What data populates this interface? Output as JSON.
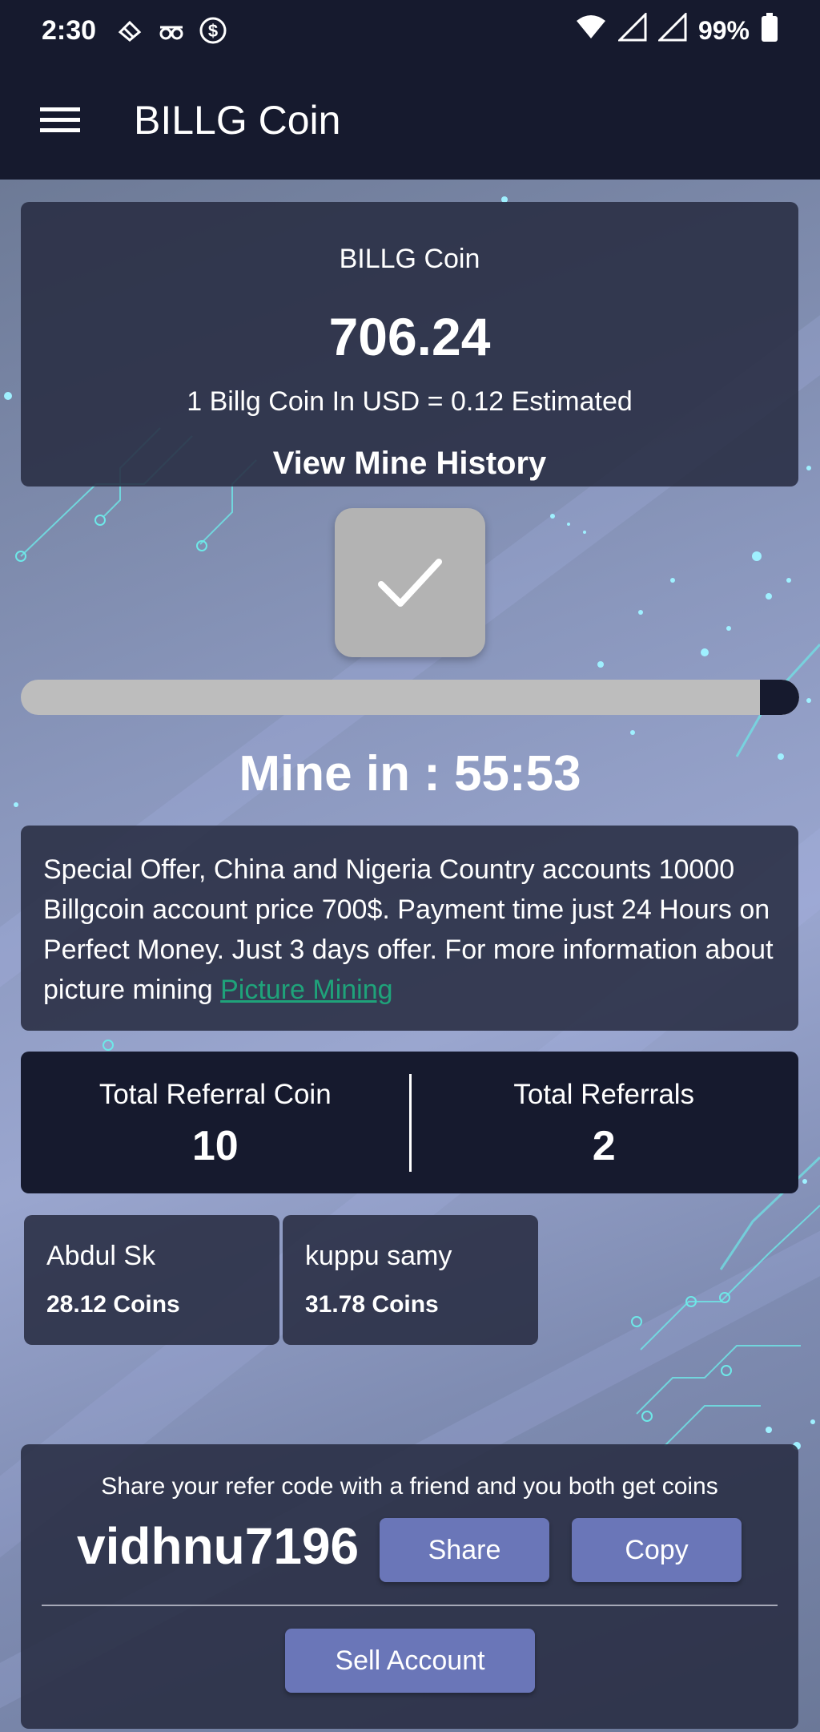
{
  "status_bar": {
    "time": "2:30",
    "battery": "99%",
    "icons": [
      "notification-icon",
      "spy-icon",
      "dollar-circle-icon",
      "wifi-icon",
      "signal-icon",
      "signal-icon",
      "battery-icon"
    ]
  },
  "app_bar": {
    "title": "BILLG Coin",
    "menu_icon": "menu-icon"
  },
  "balance": {
    "coin_name": "BILLG Coin",
    "amount": "706.24",
    "rate": "1 Billg Coin In USD = 0.12 Estimated",
    "history_label": "View Mine History"
  },
  "mine": {
    "button_icon": "check-icon",
    "progress_fraction": 0.05,
    "timer": "Mine in : 55:53"
  },
  "offer": {
    "text": "Special Offer, China and Nigeria Country accounts 10000 Billgcoin account price 700$. Payment time just 24 Hours on Perfect Money. Just 3 days offer. For more information about picture mining ",
    "link_label": "Picture Mining"
  },
  "referral_stats": {
    "total_coin_label": "Total Referral Coin",
    "total_coin_value": "10",
    "total_referrals_label": "Total Referrals",
    "total_referrals_value": "2"
  },
  "referrals": [
    {
      "name": "Abdul Sk",
      "coins": "28.12 Coins"
    },
    {
      "name": "kuppu samy",
      "coins": "31.78 Coins"
    }
  ],
  "share": {
    "message": "Share your refer code with a friend and you both get coins",
    "code": "vidhnu7196",
    "share_label": "Share",
    "copy_label": "Copy",
    "sell_label": "Sell Account"
  },
  "colors": {
    "primary_dark": "#161a2e",
    "card": "#282c42",
    "button": "#6a76b8",
    "link": "#1fa37a",
    "accent": "#5ee0e8"
  }
}
